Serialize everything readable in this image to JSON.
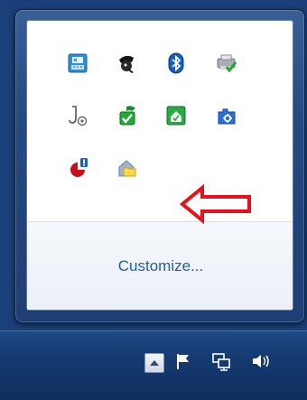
{
  "flyout": {
    "customize_label": "Customize...",
    "icons": [
      {
        "name": "keyboard-app-icon"
      },
      {
        "name": "pirate-app-icon"
      },
      {
        "name": "bluetooth-icon"
      },
      {
        "name": "printer-check-icon"
      },
      {
        "name": "audio-settings-icon"
      },
      {
        "name": "green-checkmark-app-icon"
      },
      {
        "name": "green-house-icon"
      },
      {
        "name": "blue-gear-app-icon"
      },
      {
        "name": "red-alert-pie-icon"
      },
      {
        "name": "house-folder-icon"
      }
    ]
  },
  "colors": {
    "link": "#1e5fa8",
    "annotation_arrow": "#e8101a",
    "taskbar": "#153a70"
  },
  "taskbar": {
    "tray_icons": [
      "show-hidden-icons-icon",
      "action-center-flag-icon",
      "network-icon",
      "volume-icon"
    ]
  }
}
